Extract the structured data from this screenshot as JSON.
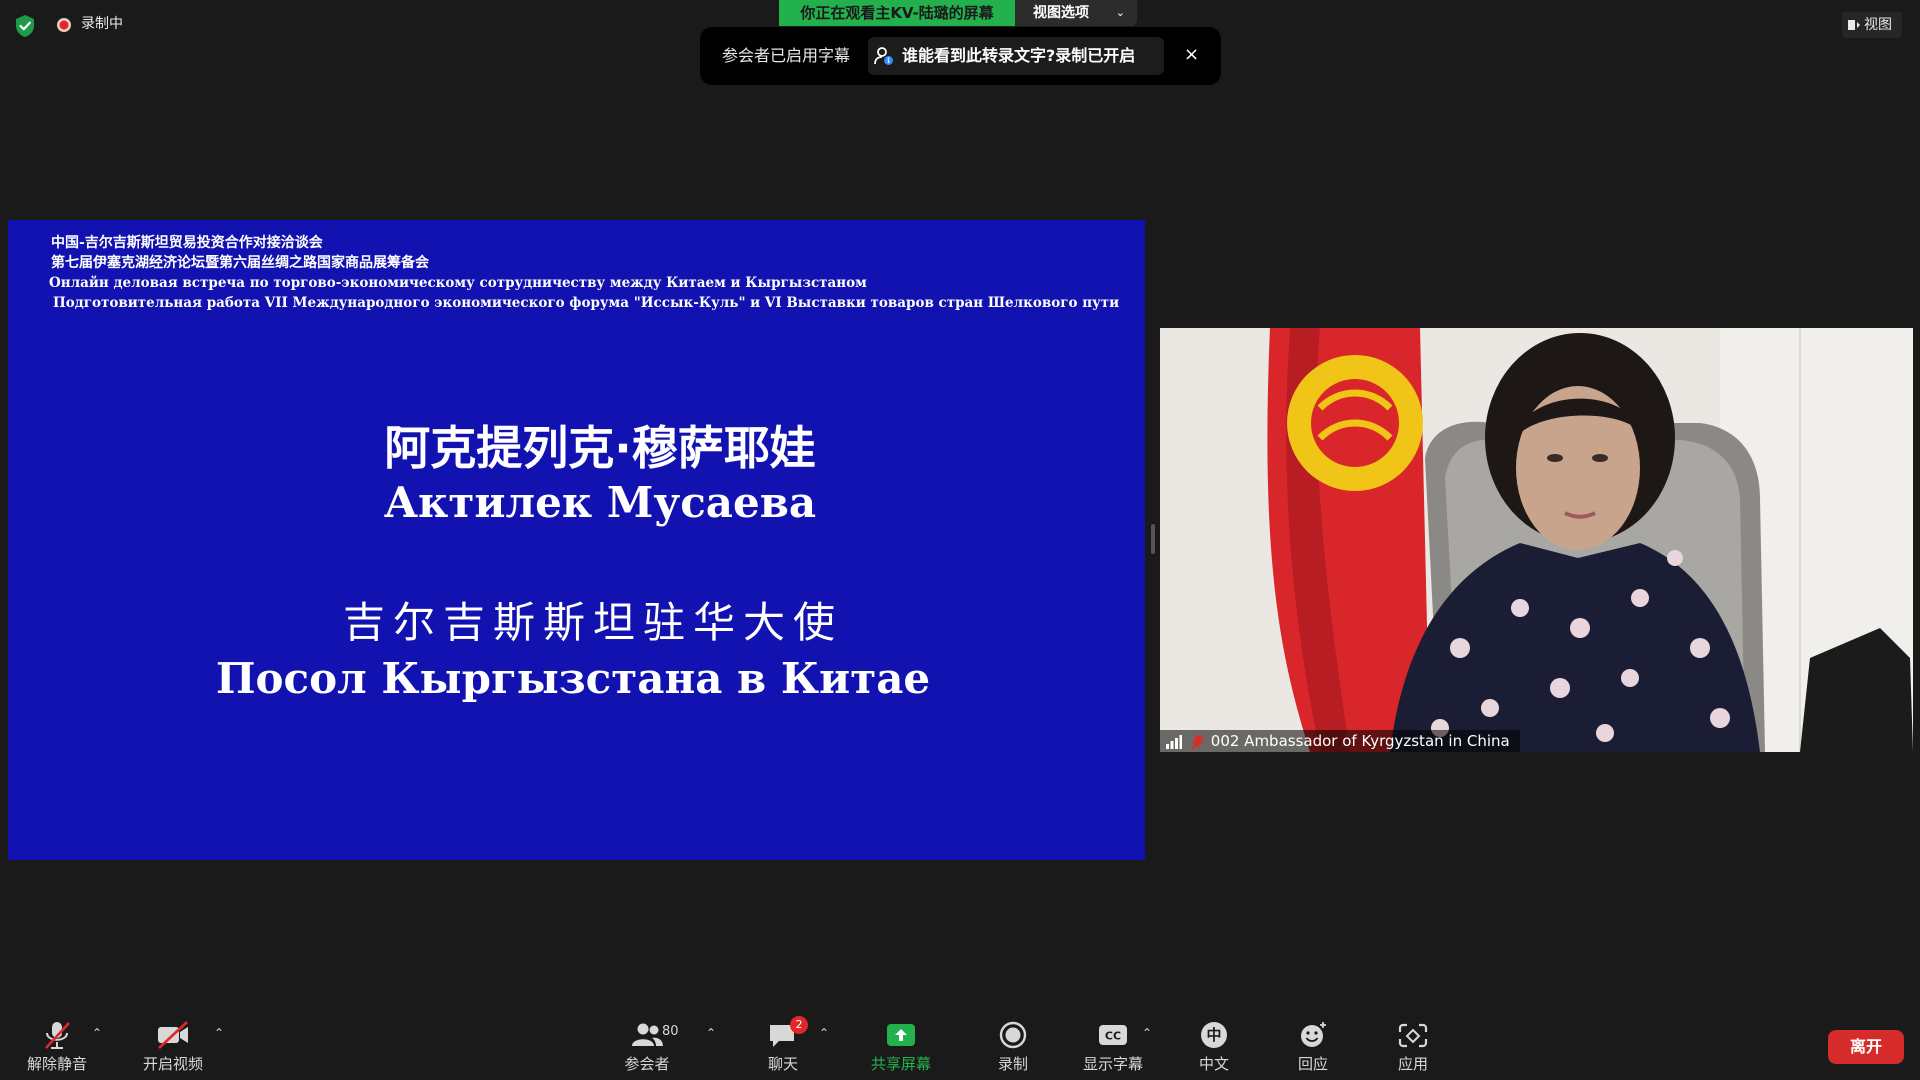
{
  "status": {
    "recording_label": "录制中"
  },
  "banner": {
    "viewing_text": "你正在观看主KV-陆璐的屏幕",
    "view_options_label": "视图选项"
  },
  "toast": {
    "message": "参会者已启用字幕",
    "question": "谁能看到此转录文字?录制已开启",
    "close_symbol": "×"
  },
  "topright": {
    "view_label": "视图"
  },
  "slide": {
    "header_lines": [
      "中国-吉尔吉斯斯坦贸易投资合作对接洽谈会",
      "第七届伊塞克湖经济论坛暨第六届丝绸之路国家商品展筹备会",
      "Онлайн деловая встреча по торгово-экономическому сотрудничеству между Китаем и Кыргызстаном",
      "Подготовительная работа VII Международного экономического форума \"Иссык-Куль\" и VI Выставки товаров стран Шелкового пути"
    ],
    "name_zh": "阿克提列克·穆萨耶娃",
    "name_ru": "Актилек Мусаева",
    "title_zh": "吉尔吉斯斯坦驻华大使",
    "title_ru": "Посол Кыргызстана в Китае",
    "background": "#1212b0"
  },
  "video": {
    "participant_name": "002 Ambassador of Kyrgyzstan in China"
  },
  "toolbar": {
    "unmute_label": "解除静音",
    "start_video_label": "开启视频",
    "participants_label": "参会者",
    "participants_count": "80",
    "chat_label": "聊天",
    "chat_badge": "2",
    "share_label": "共享屏幕",
    "record_label": "录制",
    "captions_label": "显示字幕",
    "language_label": "中文",
    "language_icon_text": "中",
    "reactions_label": "回应",
    "apps_label": "应用",
    "leave_label": "离开",
    "caret": "⌃"
  },
  "colors": {
    "share_green": "#23b14d",
    "leave_red": "#d62b2b",
    "muted_red": "#e02828"
  }
}
